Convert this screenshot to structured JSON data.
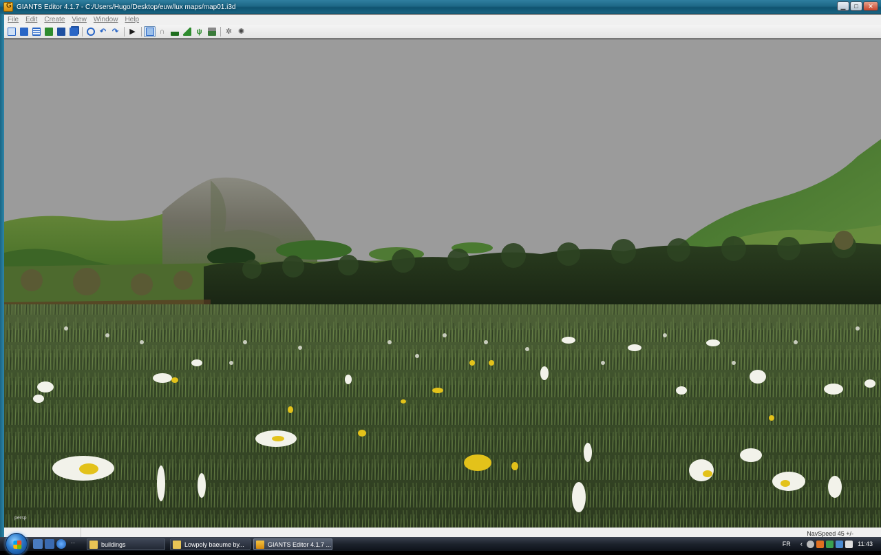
{
  "window": {
    "title": "GIANTS Editor 4.1.7 - C:/Users/Hugo/Desktop/euw/lux maps/map01.i3d",
    "controls": {
      "minimize": "▁",
      "maximize": "□",
      "close": "✕"
    }
  },
  "menubar": {
    "items": [
      {
        "label": "File"
      },
      {
        "label": "Edit"
      },
      {
        "label": "Create"
      },
      {
        "label": "View"
      },
      {
        "label": "Window"
      },
      {
        "label": "Help"
      }
    ]
  },
  "toolbar": {
    "groups": [
      [
        "new-icon",
        "open-icon",
        "save-as-icon",
        "reload-icon",
        "save-icon",
        "save-all-icon"
      ],
      [
        "import-icon",
        "undo-icon",
        "redo-icon"
      ],
      [
        "play-icon"
      ],
      [
        "select-mode-icon",
        "move-mode-icon",
        "terrain-sculpt-icon",
        "terrain-paint-icon",
        "foliage-paint-icon",
        "foliage-erase-icon"
      ],
      [
        "settings-icon",
        "settings-advanced-icon"
      ]
    ],
    "colors": {
      "blue": "#2a66c6",
      "green": "#2e8b2e",
      "dark": "#1a1a1a"
    }
  },
  "viewport": {
    "camera_label": "persp",
    "sky_color": "#9b9b9b"
  },
  "statusbar": {
    "navspeed": "NavSpeed 45 +/-"
  },
  "taskbar": {
    "buttons": [
      {
        "label": "buildings",
        "icon": "folder-icon"
      },
      {
        "label": "Lowpoly baeume by...",
        "icon": "folder-icon"
      },
      {
        "label": "GIANTS Editor 4.1.7 ...",
        "icon": "giants-editor-icon",
        "active": true
      }
    ],
    "language": "FR",
    "clock": "11:43"
  }
}
